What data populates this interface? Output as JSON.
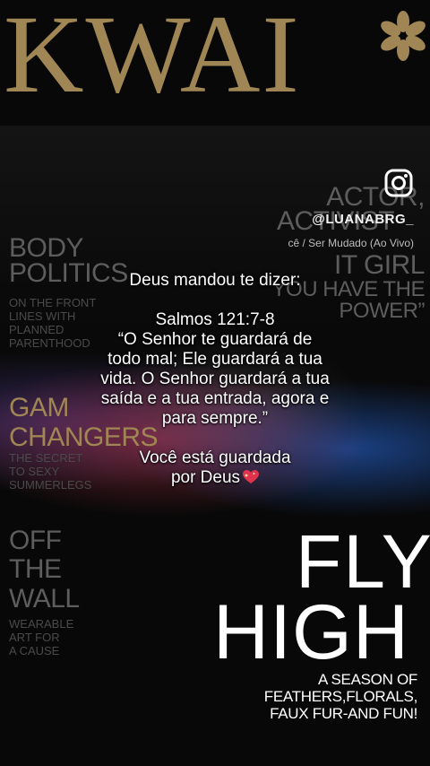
{
  "masthead": {
    "title": "KWAI"
  },
  "magazine": {
    "actor_lines": [
      "ACTOR,",
      "ACTIVIST",
      "IT GIRL",
      "YOU HAVE THE",
      "POWER”"
    ],
    "body_politics": [
      "BODY",
      "POLITICS"
    ],
    "body_sub": [
      "ON THE FRONT",
      "LINES WITH",
      "PLANNED",
      "PARENTHOOD"
    ],
    "gam": "GAM",
    "changers": "CHANGERS",
    "changers_sub": [
      "THE SECRET",
      "TO SEXY",
      "SUMMERLEGS"
    ],
    "off_wall": [
      "OFF",
      "THE",
      "WALL"
    ],
    "wearable": [
      "WEARABLE",
      "ART FOR",
      "A CAUSE"
    ],
    "fly": "FLY",
    "high": "HIGH",
    "season_lines": [
      "A SEASON OF",
      "FEATHERS,FLORALS,",
      "FAUX FUR-AND FUN!"
    ]
  },
  "profile": {
    "handle": "@LUANABRG_",
    "song": "cê / Ser Mudado (Ao Vivo)",
    "icon": "instagram-icon"
  },
  "message": {
    "intro": "Deus mandou te dizer:",
    "reference": "Salmos 121:7-8",
    "verse_lines": [
      "“O Senhor te guardará de",
      "todo mal; Ele guardará a tua",
      "vida. O Senhor guardará a tua",
      "saída e a tua entrada, agora e",
      "para sempre.”"
    ],
    "closing_lines": [
      "Você está guardada",
      "por Deus"
    ],
    "emoji": "sparkling-heart-icon"
  },
  "colors": {
    "gold": "#a08654",
    "ghost": "#5d5d5d"
  }
}
